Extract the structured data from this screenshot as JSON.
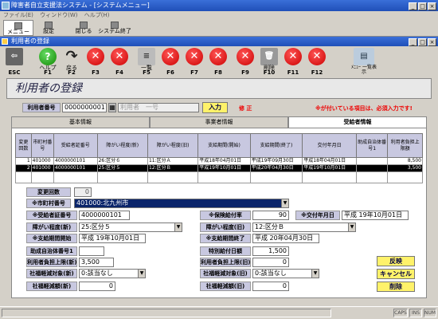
{
  "window": {
    "title": "障害者自立支援法システム - [システムメニュー]"
  },
  "menu": [
    "ファイル(E)",
    "ウィンドウ(W)",
    "ヘルプ(H)"
  ],
  "app_toolbar": [
    {
      "label": "メニュー",
      "icon": "menu-icon"
    },
    {
      "label": "設定",
      "icon": "settings-icon"
    },
    {
      "label": "閉じる",
      "icon": "close-icon"
    },
    {
      "label": "システム終了",
      "icon": "exit-icon"
    }
  ],
  "subwindow": {
    "title": "利用者の登録"
  },
  "fkeys": [
    {
      "label": "",
      "key": "ESC",
      "icon": "exit-door-icon"
    },
    {
      "label": "ヘルプ",
      "key": "F1",
      "icon": "help-icon"
    },
    {
      "label": "戻る",
      "key": "F2",
      "icon": "back-arrow-icon"
    },
    {
      "label": "",
      "key": "F3",
      "icon": "x-icon"
    },
    {
      "label": "",
      "key": "F4",
      "icon": "x-icon"
    },
    {
      "label": "一覧",
      "key": "F5",
      "icon": "list-icon"
    },
    {
      "label": "",
      "key": "F6",
      "icon": "x-icon"
    },
    {
      "label": "",
      "key": "F7",
      "icon": "x-icon"
    },
    {
      "label": "",
      "key": "F8",
      "icon": "x-icon"
    },
    {
      "label": "",
      "key": "F9",
      "icon": "x-icon"
    },
    {
      "label": "削除",
      "key": "F10",
      "icon": "trash-icon"
    },
    {
      "label": "",
      "key": "F11",
      "icon": "x-icon"
    },
    {
      "label": "",
      "key": "F12",
      "icon": "x-icon"
    }
  ],
  "print_button": {
    "label": "ﾒﾆｭｰ 一覧表示"
  },
  "page": {
    "heading": "利用者の登録"
  },
  "search": {
    "label": "利用者番号",
    "value": "0000000001",
    "name_placeholder": "利用者　一号",
    "enter_label": "入力",
    "mode": "修 正",
    "note": "※が付いている項目は、必須入力です!"
  },
  "tabs": [
    "基本情報",
    "事業者情報",
    "受給者情報"
  ],
  "grid": {
    "headers": [
      "変更回数",
      "市町村番号",
      "受給者証番号",
      "障がい程度(新)",
      "障がい程度(旧)",
      "支給期間(開始)",
      "支給期間(終了)",
      "交付年月日",
      "助成自治体番号1",
      "利用者負担上限額"
    ],
    "rows": [
      [
        "1",
        "401000",
        "4000000101",
        "26:区分６",
        "11:区分Ａ",
        "平成18年04月01日",
        "平成19年09月30日",
        "平成18年04月01日",
        "",
        "8,500"
      ],
      [
        "2",
        "401000",
        "4000000101",
        "25:区分５",
        "12:区分Ｂ",
        "平成19年10月01日",
        "平成20年04月30日",
        "平成19年10月01日",
        "",
        "3,500"
      ]
    ]
  },
  "form": {
    "change_count": {
      "label": "変更回数",
      "value": "0"
    },
    "city": {
      "label": "※市町村番号",
      "value": "401000:北九州市"
    },
    "cert_no": {
      "label": "※受給者証番号",
      "value": "4000000101"
    },
    "insurance_rate": {
      "label": "※保険給付率",
      "value": "90"
    },
    "issue_date": {
      "label": "※交付年月日",
      "value": "平成 19年10月01日"
    },
    "level_new": {
      "label": "障がい程度(新)",
      "value": "25:区分５"
    },
    "level_old": {
      "label": "障がい程度(旧)",
      "value": "12:区分Ｂ"
    },
    "period_start": {
      "label": "※支給期間開始",
      "value": "平成 19年10月01日"
    },
    "period_end": {
      "label": "※支給期間終了",
      "value": "平成 20年04月30日"
    },
    "subsidy_no": {
      "label": "助成自治体番号1",
      "value": ""
    },
    "special_payment": {
      "label": "特別給付日額",
      "value": "1,500"
    },
    "limit_new": {
      "label": "利用者負担上限(新)",
      "value": "3,500"
    },
    "limit_old": {
      "label": "利用者負担上限(旧)",
      "value": "0"
    },
    "social_new": {
      "label": "社福軽減対象(新)",
      "value": "0:該当なし"
    },
    "social_old": {
      "label": "社福軽減対象(旧)",
      "value": "0:該当なし"
    },
    "social_amt_new": {
      "label": "社福軽減額(新)",
      "value": "0"
    },
    "social_amt_old": {
      "label": "社福軽減額(旧)",
      "value": "0"
    }
  },
  "buttons": {
    "reflect": "反映",
    "cancel": "キャンセル",
    "delete": "削除"
  },
  "status": [
    "CAPS",
    "INS",
    "NUM"
  ]
}
